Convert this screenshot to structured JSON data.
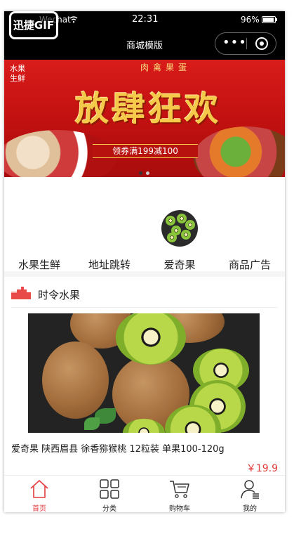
{
  "status_bar": {
    "carrier": "Wechat",
    "time": "22:31",
    "battery": "96%",
    "battery_level": 0.96
  },
  "nav": {
    "title": "商城模版",
    "menu_glyph": "•••"
  },
  "logo_badge": "迅捷GIF",
  "banner": {
    "top_text": "肉禽果蛋",
    "corner_text": "水果\n生鲜",
    "headline": "放肆狂欢",
    "coupon": "领券满199减100",
    "active_slide": 0,
    "slide_count": 2,
    "colors": {
      "active_dot": "#333333",
      "inactive_dot": "#cccccc"
    }
  },
  "categories": [
    {
      "label": "水果生鲜",
      "icon": null
    },
    {
      "label": "地址跳转",
      "icon": null
    },
    {
      "label": "爱奇果",
      "icon": "kiwi-thumbnail"
    },
    {
      "label": "商品广告",
      "icon": null
    }
  ],
  "section": {
    "title": "时令水果",
    "icon": "stairs-icon",
    "accent": "#e84a4a"
  },
  "product": {
    "name": "爱奇果 陕西眉县 徐香猕猴桃 12粒装 单果100-120g",
    "price": "￥19.9",
    "image": "kiwi-photo"
  },
  "tabbar": {
    "active_color": "#e33c3c",
    "items": [
      {
        "label": "首页",
        "icon": "home-icon",
        "active": true
      },
      {
        "label": "分类",
        "icon": "grid-icon",
        "active": false
      },
      {
        "label": "购物车",
        "icon": "cart-icon",
        "active": false
      },
      {
        "label": "我的",
        "icon": "user-icon",
        "active": false
      }
    ]
  }
}
